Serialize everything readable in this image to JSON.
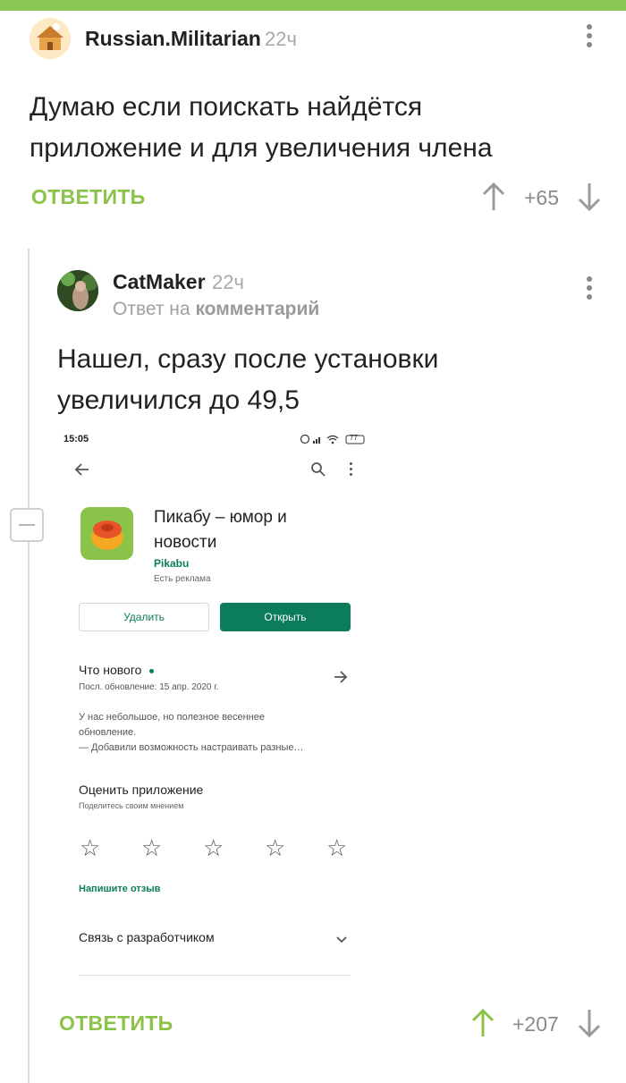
{
  "comments": [
    {
      "username": "Russian.Militarian",
      "time": "22ч",
      "text_line1": "Думаю если поискать найдётся",
      "text_line2": "приложение и для увеличения члена",
      "reply_label": "ОТВЕТИТЬ",
      "score": "+65"
    },
    {
      "username": "CatMaker",
      "time": "22ч",
      "reply_prefix": "Ответ на",
      "reply_target": "комментарий",
      "text_line1": "Нашел, сразу после установки",
      "text_line2": "увеличился до 49,5",
      "reply_label": "ОТВЕТИТЬ",
      "score": "+207"
    }
  ],
  "screenshot": {
    "status_time": "15:05",
    "battery": "77",
    "app_title_line1": "Пикабу – юмор и",
    "app_title_line2": "новости",
    "developer": "Pikabu",
    "ads_note": "Есть реклама",
    "uninstall_label": "Удалить",
    "open_label": "Открыть",
    "whats_new_title": "Что нового",
    "last_update": "Посл. обновление: 15 апр. 2020 г.",
    "update_line1": "У нас небольшое, но полезное весеннее",
    "update_line2": "обновление.",
    "update_line3": "— Добавили возможность настраивать разные…",
    "rate_title": "Оценить приложение",
    "rate_sub": "Поделитесь своим мнением",
    "write_review": "Напишите отзыв",
    "contact_dev": "Связь с разработчиком"
  },
  "colors": {
    "accent_green": "#8bc34a",
    "play_green": "#0b7d5d"
  }
}
